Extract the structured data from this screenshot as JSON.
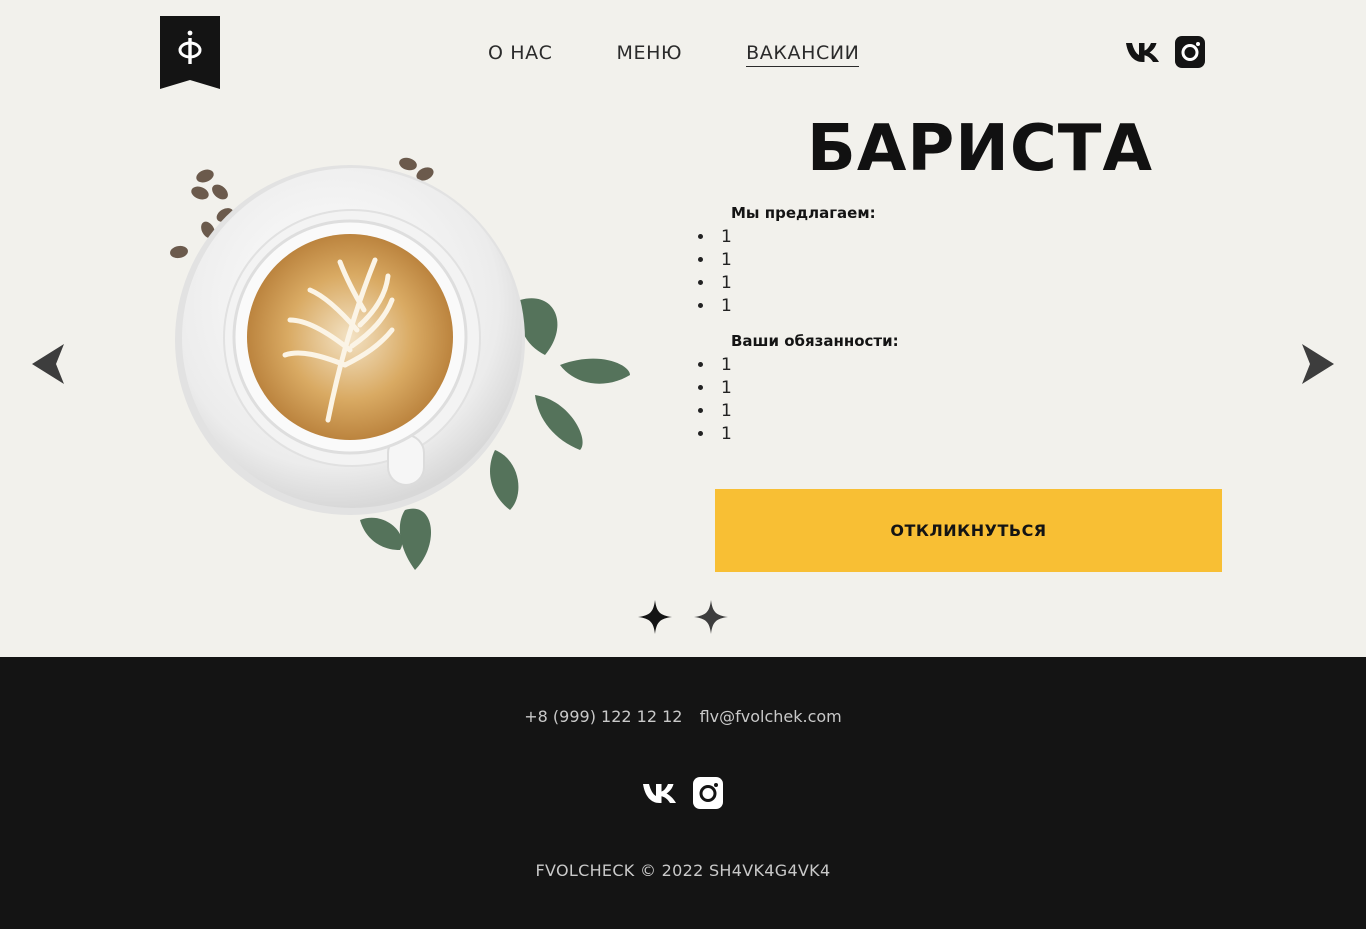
{
  "header": {
    "nav": [
      {
        "label": "О НАС",
        "active": false
      },
      {
        "label": "МЕНЮ",
        "active": false
      },
      {
        "label": "ВАКАНСИИ",
        "active": true
      }
    ],
    "social": [
      "vk-icon",
      "instagram-icon"
    ]
  },
  "vacancy": {
    "title": "БАРИСТА",
    "offer_heading": "Мы предлагаем:",
    "offer_items": [
      "1",
      "1",
      "1",
      "1"
    ],
    "duties_heading": "Ваши обязанности:",
    "duties_items": [
      "1",
      "1",
      "1",
      "1"
    ],
    "apply_label": "ОТКЛИКНУТЬСЯ"
  },
  "carousel": {
    "prev_icon": "arrow-left-icon",
    "next_icon": "arrow-right-icon",
    "slides_count": 2,
    "active_index": 0
  },
  "footer": {
    "phone": "+8 (999) 122 12 12",
    "email": "flv@fvolchek.com",
    "copyright": "FVOLCHECK © 2022 SH4VK4G4VK4"
  },
  "colors": {
    "background": "#f2f1ec",
    "accent": "#f8bf34",
    "footer": "#141414",
    "text": "#141414"
  }
}
